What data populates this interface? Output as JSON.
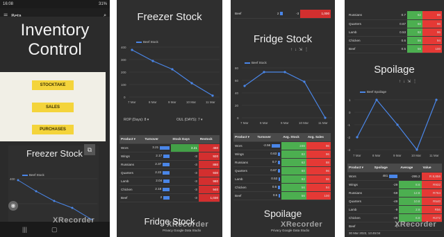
{
  "screen1": {
    "status_time": "16:08",
    "status_right": "31%",
    "app_label": "Beta",
    "title_line1": "Inventory",
    "title_line2": "Control",
    "buttons": [
      "STOCKTAKE",
      "SALES",
      "PURCHASES"
    ],
    "card_title": "Freezer Stock",
    "legend": "Beef Stock",
    "y_ticks": [
      "400",
      "200"
    ],
    "watermark": "XRecorder"
  },
  "screen2": {
    "title": "Freezer Stock",
    "legend": "Beef Stock",
    "y_ticks": [
      "400",
      "300",
      "200",
      "100",
      "0"
    ],
    "x_ticks": [
      "7 Mar",
      "8 Mar",
      "9 Mar",
      "10 Mar",
      "11 Mar"
    ],
    "dropdown1": "ROP (Days): 8",
    "dropdown2": "OUL (DAYS): 7",
    "headers": [
      "Product",
      "Turnover",
      "Stock Days",
      "Restock"
    ],
    "rows": [
      {
        "product": "Wors",
        "turnover": "3.21",
        "days": "3.21",
        "restock": "460"
      },
      {
        "product": "Wings",
        "turnover": "2.17",
        "days": "-3",
        "restock": "920"
      },
      {
        "product": "Russians",
        "turnover": "2.37",
        "days": "-3",
        "restock": "880"
      },
      {
        "product": "Quarters",
        "turnover": "2.22",
        "days": "-3",
        "restock": "930"
      },
      {
        "product": "Lamb",
        "turnover": "2.04",
        "days": "-3",
        "restock": "980"
      },
      {
        "product": "Chicken",
        "turnover": "2.18",
        "days": "-3",
        "restock": "940"
      },
      {
        "product": "Beef",
        "turnover": "2",
        "days": "-3",
        "restock": "1,030"
      }
    ],
    "next_title": "Fridge Stock",
    "footer": "Privacy   Google Data Studio",
    "watermark": "XRecorder"
  },
  "screen3": {
    "top_row": {
      "product": "Beef",
      "turnover": "2",
      "stock": "-3",
      "sales": "1,000"
    },
    "title": "Fridge Stock",
    "legend": "Beef Stock",
    "y_ticks": [
      "80",
      "60",
      "40",
      "20",
      "0"
    ],
    "x_ticks": [
      "7 Mar",
      "8 Mar",
      "9 Mar",
      "10 Mar",
      "11 Mar"
    ],
    "headers": [
      "Product",
      "Turnover",
      "Avg. Stock",
      "Avg. Sales"
    ],
    "rows": [
      {
        "product": "Wors",
        "turnover": "-2.56",
        "stock": "246",
        "sales": "96"
      },
      {
        "product": "Wings",
        "turnover": "0.63",
        "stock": "82",
        "sales": "96"
      },
      {
        "product": "Russians",
        "turnover": "0.7",
        "stock": "62",
        "sales": "88"
      },
      {
        "product": "Quarters",
        "turnover": "0.67",
        "stock": "60",
        "sales": "96"
      },
      {
        "product": "Lamb",
        "turnover": "0.53",
        "stock": "92",
        "sales": "96"
      },
      {
        "product": "Chicken",
        "turnover": "0.6",
        "stock": "56",
        "sales": "94"
      },
      {
        "product": "Beef",
        "turnover": "0.5",
        "stock": "56",
        "sales": "100"
      }
    ],
    "next_title": "Spoilage",
    "footer": "Privacy   Google Data Studio",
    "watermark": "XRecorder"
  },
  "screen4": {
    "top_rows": [
      {
        "product": "Russians",
        "turnover": "0.7",
        "stock": "62",
        "sales": "88"
      },
      {
        "product": "Quarters",
        "turnover": "0.67",
        "stock": "60",
        "sales": "96"
      },
      {
        "product": "Lamb",
        "turnover": "0.53",
        "stock": "92",
        "sales": "96"
      },
      {
        "product": "Chicken",
        "turnover": "0.6",
        "stock": "56",
        "sales": "94"
      },
      {
        "product": "Beef",
        "turnover": "0.5",
        "stock": "56",
        "sales": "100"
      }
    ],
    "title": "Spoilage",
    "legend": "Beef Spoilage",
    "y_ticks": [
      "1",
      "0",
      "-1",
      "-2",
      "-3"
    ],
    "x_ticks": [
      "7 Mar",
      "8 Mar",
      "9 Mar",
      "10 Mar",
      "11 Mar"
    ],
    "headers": [
      "Product",
      "Spoilage",
      "Average",
      "Value"
    ],
    "rows": [
      {
        "product": "Wors",
        "spoilage": "481",
        "average": "-295.2",
        "value": "R 8,856"
      },
      {
        "product": "Wings",
        "spoilage": "-29",
        "average": "8.6",
        "value": "R932"
      },
      {
        "product": "Russians",
        "spoilage": "-59",
        "average": "12.8",
        "value": "R764"
      },
      {
        "product": "Quarters",
        "spoilage": "-49",
        "average": "10.8",
        "value": "R540"
      },
      {
        "product": "Lamb",
        "spoilage": "-9",
        "average": "2.8",
        "value": "R56"
      },
      {
        "product": "Chicken",
        "spoilage": "-29",
        "average": "6.8",
        "value": "R272"
      },
      {
        "product": "Beef",
        "spoilage": "1",
        "average": "",
        "value": ""
      }
    ],
    "date": "30 Mar 2022, 13:45:04",
    "watermark": "XRecorder"
  },
  "colors": {
    "accent": "#4a86e8",
    "button": "#f4d43b",
    "good": "#43a047",
    "bad": "#d32f2f"
  }
}
